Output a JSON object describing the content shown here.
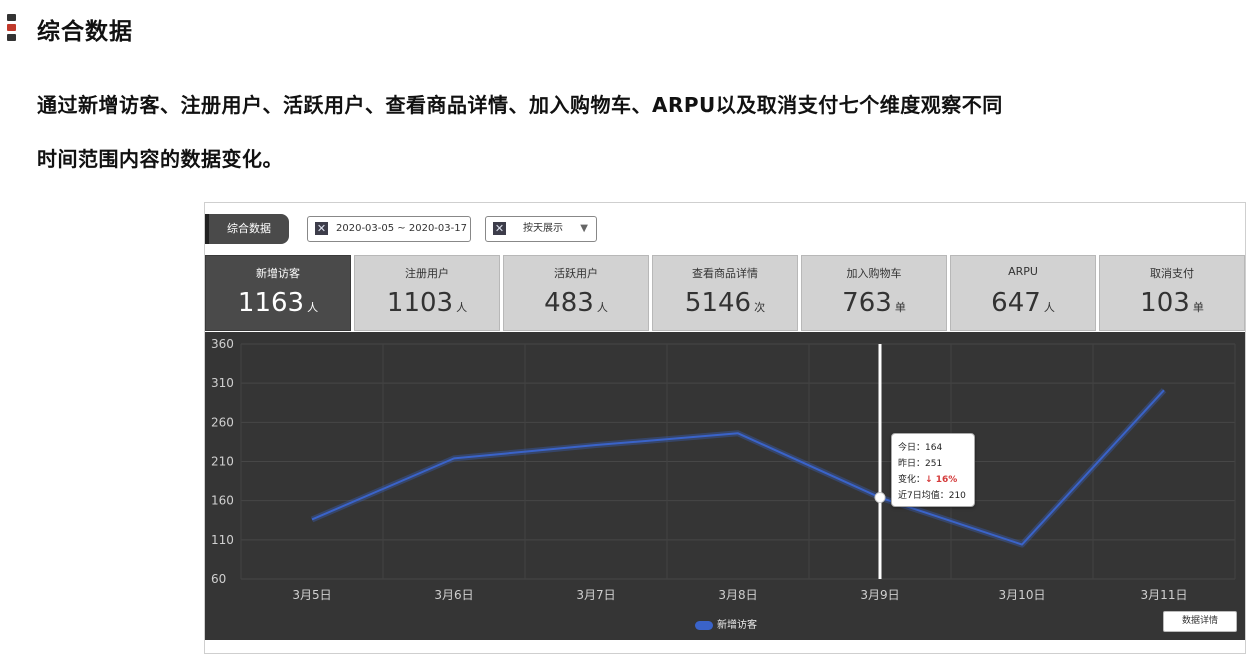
{
  "slide": {
    "title": "综合数据",
    "intro_line1": "通过新增访客、注册用户、活跃用户、查看商品详情、加入购物车、ARPU以及取消支付七个维度观察不同",
    "intro_line2": "时间范围内容的数据变化。",
    "bar_colors": [
      "#333333",
      "#c0392b",
      "#333333"
    ]
  },
  "toolbar": {
    "tab_label": "综合数据",
    "date_range": "2020-03-05 ~ 2020-03-17",
    "date_icon": "close-x-icon",
    "granularity": "按天展示",
    "granularity_icon": "close-x-icon",
    "dropdown_icon": "caret-down-icon"
  },
  "metrics": [
    {
      "label": "新增访客",
      "value": "1163",
      "unit": "人",
      "active": true
    },
    {
      "label": "注册用户",
      "value": "1103",
      "unit": "人",
      "active": false
    },
    {
      "label": "活跃用户",
      "value": "483",
      "unit": "人",
      "active": false
    },
    {
      "label": "查看商品详情",
      "value": "5146",
      "unit": "次",
      "active": false
    },
    {
      "label": "加入购物车",
      "value": "763",
      "unit": "单",
      "active": false
    },
    {
      "label": "ARPU",
      "value": "647",
      "unit": "人",
      "active": false
    },
    {
      "label": "取消支付",
      "value": "103",
      "unit": "单",
      "active": false
    }
  ],
  "tooltip": {
    "today": "今日：164",
    "yesterday": "昨日：251",
    "change_label": "变化：",
    "change_value": "↓ 16%",
    "avg": "近7日均值：210"
  },
  "legend_label": "新增访客",
  "detail_button": "数据详情",
  "colors": {
    "line": "#3a63c9",
    "panel_bg": "#353535",
    "card_active": "#4a4a4a",
    "card": "#d2d2d2"
  },
  "chart_data": {
    "type": "line",
    "categories": [
      "3月5日",
      "3月6日",
      "3月7日",
      "3月8日",
      "3月9日",
      "3月10日",
      "3月11日"
    ],
    "series": [
      {
        "name": "新增访客",
        "values": [
          136,
          214,
          231,
          246,
          164,
          104,
          301
        ]
      }
    ],
    "yticks": [
      60,
      110,
      160,
      210,
      260,
      310,
      360
    ],
    "ylim": [
      60,
      360
    ],
    "grid": true,
    "legend": "bottom-center",
    "highlight_index": 4
  }
}
